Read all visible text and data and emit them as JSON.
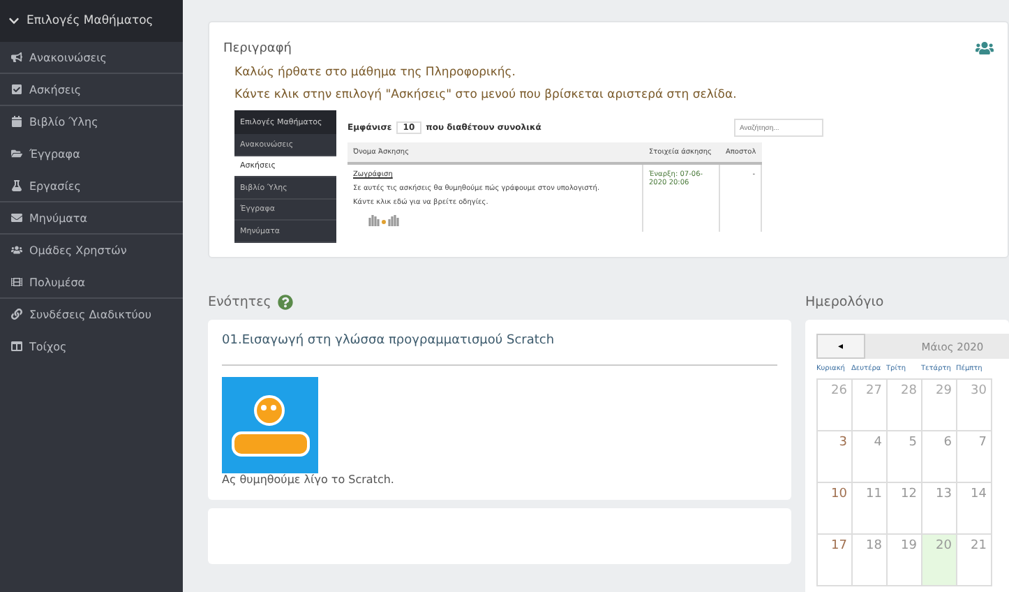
{
  "sidebar": {
    "header": "Επιλογές Μαθήματος",
    "expanded": true,
    "items": [
      {
        "label": "Ανακοινώσεις",
        "divider": true
      },
      {
        "label": "Ασκήσεις",
        "divider": true
      },
      {
        "label": "Βιβλίο Ύλης",
        "divider": false
      },
      {
        "label": "Έγγραφα",
        "divider": false
      },
      {
        "label": "Εργασίες",
        "divider": true
      },
      {
        "label": "Μηνύματα",
        "divider": true
      },
      {
        "label": "Ομάδες Χρηστών",
        "divider": false
      },
      {
        "label": "Πολυμέσα",
        "divider": true
      },
      {
        "label": "Συνδέσεις Διαδικτύου",
        "divider": false
      },
      {
        "label": "Τοίχος",
        "divider": false
      }
    ]
  },
  "description": {
    "title": "Περιγραφή",
    "paragraphs": [
      "Καλώς ήρθατε στο μάθημα της Πληροφορικής.",
      "Κάντε κλικ στην επιλογή \"Ασκήσεις\" στο μενού που βρίσκεται αριστερά στη σελίδα."
    ],
    "screenshot": {
      "sidebar_header": "Επιλογές Μαθήματος",
      "sidebar_items": [
        {
          "label": "Ανακοινώσεις",
          "selected": false
        },
        {
          "label": "Ασκήσεις",
          "selected": true
        },
        {
          "label": "Βιβλίο Ύλης",
          "selected": false
        },
        {
          "label": "Έγγραφα",
          "selected": false
        },
        {
          "label": "Μηνύματα",
          "selected": false
        }
      ],
      "show_label": "Εμφάνισε",
      "show_value": "10",
      "show_suffix": "που διαθέτουν συνολικά",
      "search_placeholder": "Αναζήτηση...",
      "columns": [
        "Όνομα Άσκησης",
        "Στοιχεία άσκησης",
        "Αποστολ"
      ],
      "row": {
        "link": "Ζωγράφιση",
        "text": "Σε αυτές τις ασκήσεις θα θυμηθούμε πώς γράφουμε στον υπολογιστή.",
        "hint": "Κάντε κλικ εδώ για να βρείτε οδηγίες.",
        "details": "Έναρξη: 07-06-2020 20:06",
        "column_3": "-"
      }
    }
  },
  "units": {
    "title": "Ενότητες",
    "unit_title": "01.Εισαγωγή στη γλώσσα προγραμματισμού Scratch",
    "caption": "Ας θυμηθούμε λίγο το Scratch."
  },
  "calendar": {
    "title": "Ημερολόγιο",
    "prev": "◂",
    "month": "Μάιος 2020",
    "weekdays": [
      "Κυριακή",
      "Δευτέρα",
      "Τρίτη",
      "Τετάρτη",
      "Πέμπτη"
    ],
    "weeks": [
      [
        {
          "day": "26",
          "muted": true,
          "today": false
        },
        {
          "day": "27",
          "muted": true,
          "today": false
        },
        {
          "day": "28",
          "muted": true,
          "today": false
        },
        {
          "day": "29",
          "muted": true,
          "today": false
        },
        {
          "day": "30",
          "muted": true,
          "today": false
        }
      ],
      [
        {
          "day": "3",
          "muted": false,
          "today": false
        },
        {
          "day": "4",
          "muted": false,
          "today": false
        },
        {
          "day": "5",
          "muted": false,
          "today": false
        },
        {
          "day": "6",
          "muted": false,
          "today": false
        },
        {
          "day": "7",
          "muted": false,
          "today": false
        }
      ],
      [
        {
          "day": "10",
          "muted": false,
          "today": false
        },
        {
          "day": "11",
          "muted": false,
          "today": false
        },
        {
          "day": "12",
          "muted": false,
          "today": false
        },
        {
          "day": "13",
          "muted": false,
          "today": false
        },
        {
          "day": "14",
          "muted": false,
          "today": false
        }
      ],
      [
        {
          "day": "17",
          "muted": false,
          "today": false
        },
        {
          "day": "18",
          "muted": false,
          "today": false
        },
        {
          "day": "19",
          "muted": false,
          "today": false
        },
        {
          "day": "20",
          "muted": false,
          "today": true
        },
        {
          "day": "21",
          "muted": false,
          "today": false
        }
      ]
    ]
  }
}
